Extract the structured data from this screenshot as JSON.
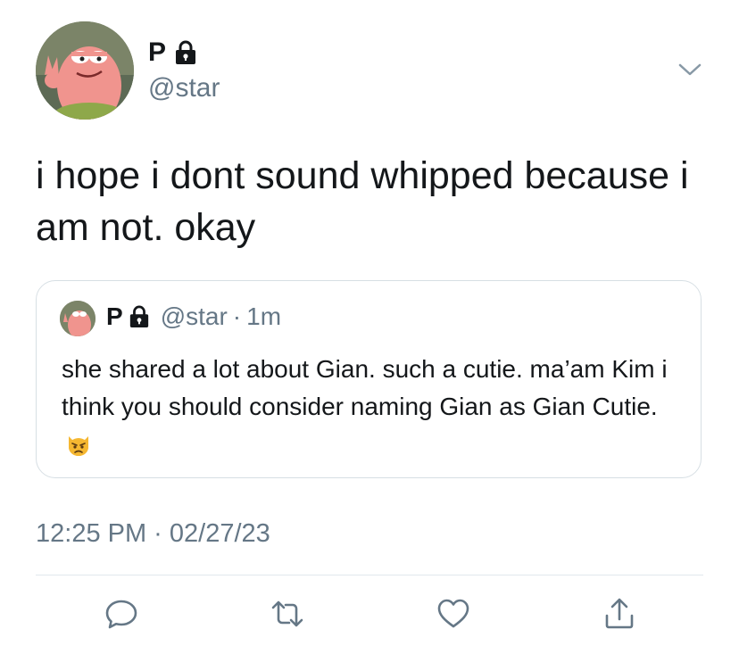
{
  "profile": {
    "name": "P",
    "handle": "@star"
  },
  "tweet": {
    "text": "i hope i dont sound whipped because i am not. okay",
    "timestamp": "12:25 PM · 02/27/23"
  },
  "quote": {
    "name": "P",
    "handle": "@star",
    "separator": "·",
    "time": "1m",
    "text": "she shared a lot about Gian. such a cutie. ma’am Kim i think you should consider naming Gian as Gian Cutie."
  },
  "icons": {
    "lock": "lock-icon",
    "chevron": "chevron-down-icon",
    "reply": "reply-icon",
    "retweet": "retweet-icon",
    "like": "heart-icon",
    "share": "share-icon",
    "emoji": "pouting-cat-emoji"
  },
  "colors": {
    "text": "#14171a",
    "secondary": "#657786",
    "border": "#d7dfe4",
    "divider": "#e1e8ed"
  }
}
